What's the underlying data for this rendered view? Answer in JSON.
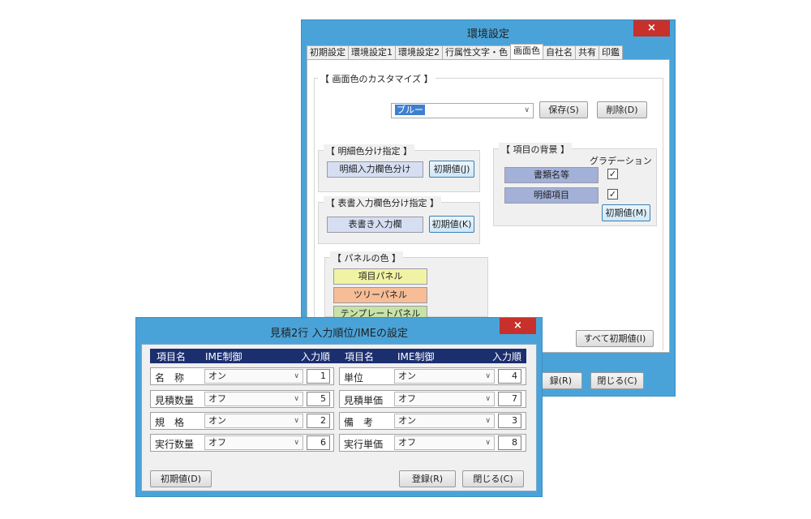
{
  "settings": {
    "title": "環境設定",
    "close": "×",
    "tabs": [
      "初期設定",
      "環境設定1",
      "環境設定2",
      "行属性文字・色",
      "画面色",
      "自社名",
      "共有",
      "印鑑"
    ],
    "customize_title": "【 画面色のカスタマイズ 】",
    "theme_value": "ブルー",
    "save_label": "保存(S)",
    "delete_label": "削除(D)",
    "detail_group": {
      "title": "【 明細色分け指定 】",
      "button": "明細入力欄色分け",
      "reset": "初期値(J)"
    },
    "cover_group": {
      "title": "【 表書入力欄色分け指定 】",
      "button": "表書き入力欄",
      "reset": "初期値(K)"
    },
    "background_group": {
      "title": "【 項目の背景 】",
      "gradation": "グラデーション",
      "item1": "書類名等",
      "item2": "明細項目",
      "check": "✓",
      "reset": "初期値(M)"
    },
    "panel_group": {
      "title": "【 パネルの色 】",
      "item_panel": "項目パネル",
      "tree_panel": "ツリーパネル",
      "template_panel": "テンプレートパネル"
    },
    "reset_all": "すべて初期値(I)",
    "register_partial": "録(R)",
    "close_label": "閉じる(C)"
  },
  "dialog": {
    "title": "見積2行 入力順位/IMEの設定",
    "close": "×",
    "headers": {
      "item_name": "項目名",
      "ime": "IME制御",
      "order": "入力順"
    },
    "rows": [
      {
        "left": {
          "name": "名　称",
          "ime": "オン",
          "order": "1"
        },
        "right": {
          "name": "単位",
          "ime": "オン",
          "order": "4"
        }
      },
      {
        "left": {
          "name": "見積数量",
          "ime": "オフ",
          "order": "5"
        },
        "right": {
          "name": "見積単価",
          "ime": "オフ",
          "order": "7"
        }
      },
      {
        "left": {
          "name": "規　格",
          "ime": "オン",
          "order": "2"
        },
        "right": {
          "name": "備　考",
          "ime": "オン",
          "order": "3"
        }
      },
      {
        "left": {
          "name": "実行数量",
          "ime": "オフ",
          "order": "6"
        },
        "right": {
          "name": "実行単価",
          "ime": "オフ",
          "order": "8"
        }
      }
    ],
    "dropdown_arrow": "∨",
    "reset": "初期値(D)",
    "register": "登録(R)",
    "close_label": "閉じる(C)"
  },
  "colors": {
    "frame": "#4aa3d8",
    "close": "#c7302b",
    "header": "#1b2e6e",
    "steel_blue": "#a3b0d8",
    "panel_yellow": "#f1f3a4",
    "panel_orange": "#f6bd96",
    "panel_green": "#c7e3a8"
  }
}
